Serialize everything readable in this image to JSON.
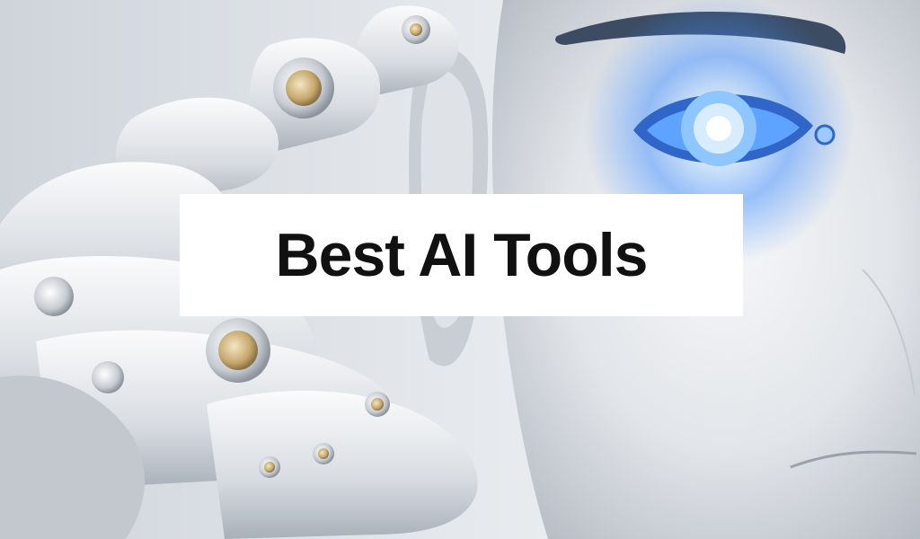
{
  "banner": {
    "title": "Best AI Tools"
  },
  "colors": {
    "background": "#dfe3e8",
    "robot_body": "#e7e9ec",
    "eye_glow": "#3f8cff",
    "title_box": "#ffffff",
    "title_text": "#111111"
  },
  "icons": {
    "robot_head": "robot-head-icon",
    "robot_eye": "glowing-eye-icon",
    "robot_hand": "robot-hand-icon"
  }
}
